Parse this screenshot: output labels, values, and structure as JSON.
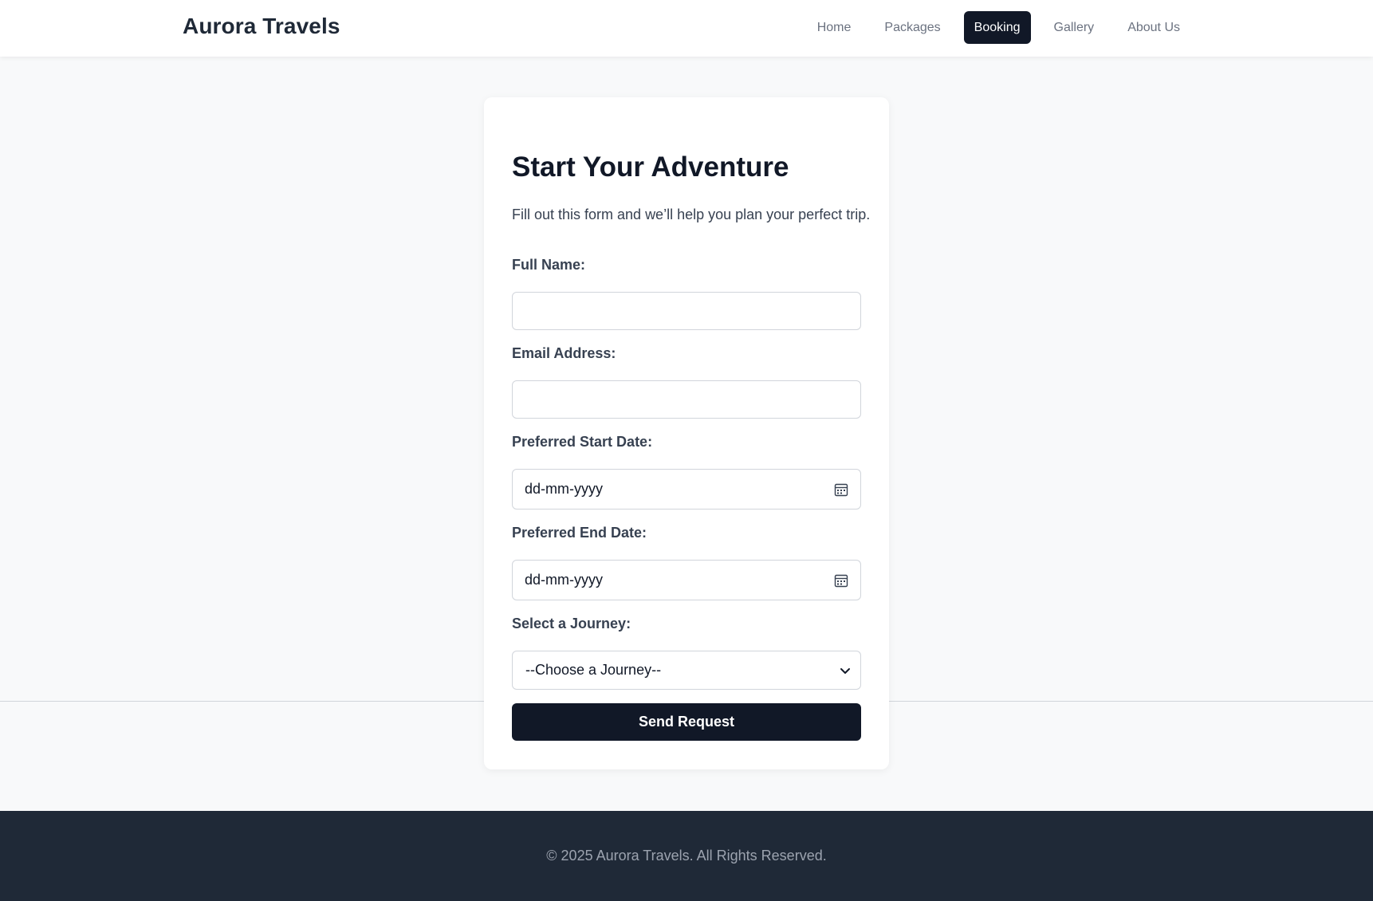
{
  "header": {
    "brand": "Aurora Travels",
    "nav": [
      {
        "label": "Home",
        "active": false
      },
      {
        "label": "Packages",
        "active": false
      },
      {
        "label": "Booking",
        "active": true
      },
      {
        "label": "Gallery",
        "active": false
      },
      {
        "label": "About Us",
        "active": false
      }
    ]
  },
  "form": {
    "title": "Start Your Adventure",
    "subtitle": "Fill out this form and we’ll help you plan your perfect trip.",
    "full_name": {
      "label": "Full Name:",
      "value": ""
    },
    "email": {
      "label": "Email Address:",
      "value": ""
    },
    "start_date": {
      "label": "Preferred Start Date:",
      "placeholder": "dd-mm-yyyy",
      "icon": "calendar-icon"
    },
    "end_date": {
      "label": "Preferred End Date:",
      "placeholder": "dd-mm-yyyy",
      "icon": "calendar-icon"
    },
    "journey": {
      "label": "Select a Journey:",
      "selected": "--Choose a Journey--",
      "icon": "chevron-down-icon"
    },
    "submit_label": "Send Request"
  },
  "footer": {
    "copyright": "© 2025 Aurora Travels. All Rights Reserved."
  },
  "colors": {
    "primary": "#111827",
    "page_bg": "#f8f9fa",
    "footer_bg": "#1f2937",
    "muted_text": "#6b7280"
  }
}
